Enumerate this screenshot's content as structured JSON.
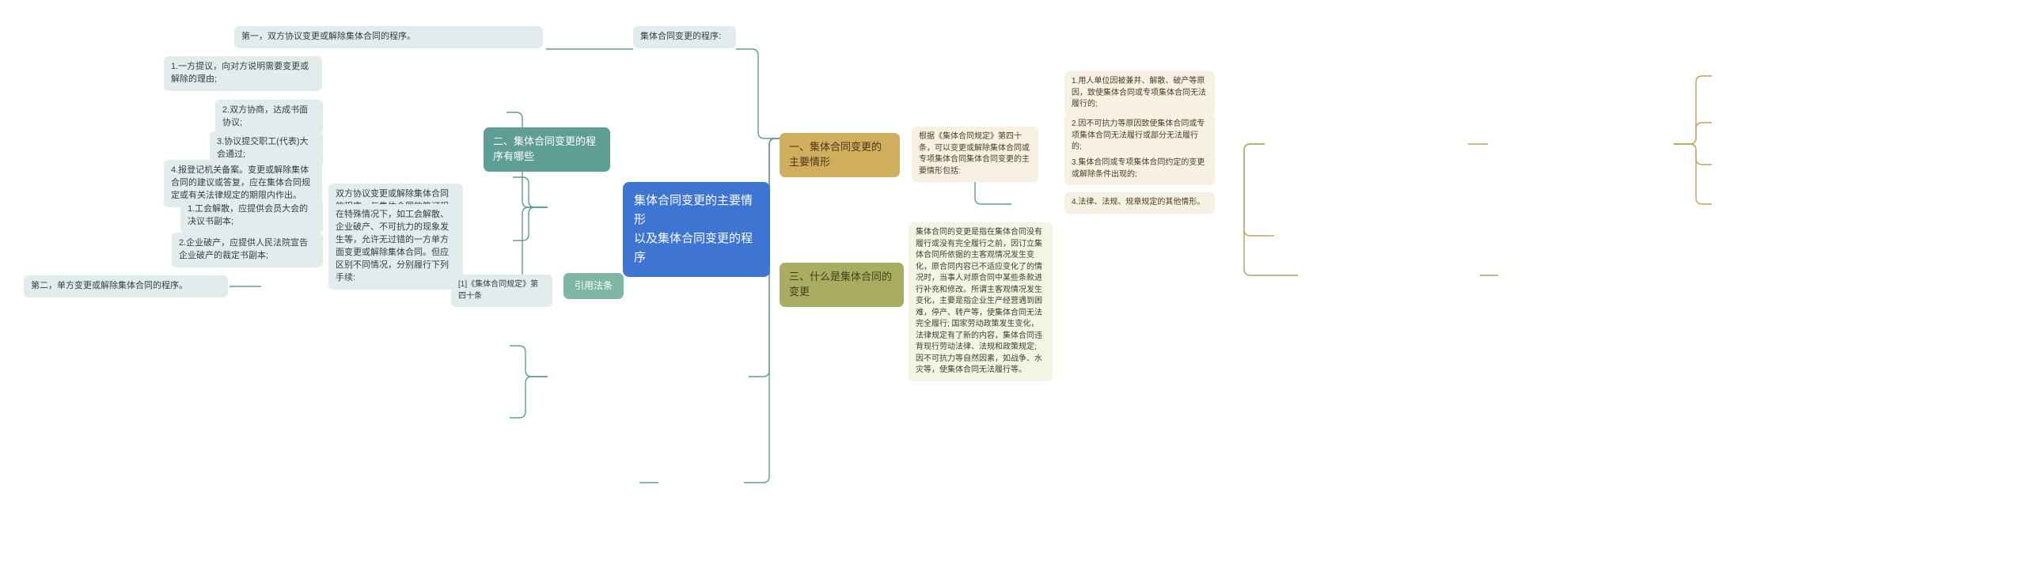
{
  "map": {
    "root": {
      "label": "集体合同变更的主要情形\n以及集体合同变更的程序",
      "color": "#3f75d2"
    },
    "branch_left": {
      "topic": "二、集体合同变更的程序有哪些",
      "color": "#5f9e95",
      "group_one": {
        "header": "集体合同变更的程序:",
        "first_item": "第一，双方协议变更或解除集体合同的程序。",
        "summary": "双方协议变更或解除集体合同的程序，与集体合同的签订程序有某些相似的地方。即:",
        "steps": [
          "1.一方提议，向对方说明需要变更或解除的理由;",
          "2.双方协商，达成书面协议;",
          "3.协议提交职工(代表)大会通过;",
          "4.报登记机关备案。变更或解除集体合同的建议或答复，应在集体合同规定或有关法律规定的期限内作出。"
        ]
      },
      "group_two": {
        "header": "第二，单方变更或解除集体合同的程序。",
        "summary": "在特殊情况下，如工会解散、企业破产、不可抗力的现象发生等，允许无过错的一方单方面变更或解除集体合同。但应区别不同情况，分别履行下列手续:",
        "steps": [
          "1.工会解散，应提供会员大会的决议书副本;",
          "2.企业破产，应提供人民法院宣告企业破产的裁定书副本;"
        ]
      },
      "citation": {
        "topic": "引用法条",
        "item": "[1]《集体合同规定》第四十条"
      }
    },
    "branch_gold": {
      "topic": "一、集体合同变更的主要情形",
      "color": "#cfae5d",
      "summary": "根据《集体合同规定》第四十条，可以变更或解除集体合同或专项集体合同集体合同变更的主要情形包括:",
      "items": [
        "1.用人单位因被兼并、解散、破产等原因，致使集体合同或专项集体合同无法履行的;",
        "2.因不可抗力等原因致使集体合同或专项集体合同无法履行或部分无法履行的;",
        "3.集体合同或专项集体合同约定的变更或解除条件出现的;",
        "4.法律、法规、规章规定的其他情形。"
      ]
    },
    "branch_olive": {
      "topic": "三、什么是集体合同的变更",
      "color": "#a8ad62",
      "summary": "集体合同的变更是指在集体合同没有履行或没有完全履行之前，因订立集体合同所依据的主客观情况发生变化，原合同内容已不适应变化了的情况时，当事人对原合同中某些条款进行补充和修改。所谓主客观情况发生变化，主要是指企业生产经营遇到困难，停产、转产等，使集体合同无法完全履行; 国家劳动政策发生变化，法律规定有了新的内容，集体合同违背现行劳动法律、法规和政策规定; 因不可抗力等自然因素，如战争、水灾等，使集体合同无法履行等。"
    }
  }
}
